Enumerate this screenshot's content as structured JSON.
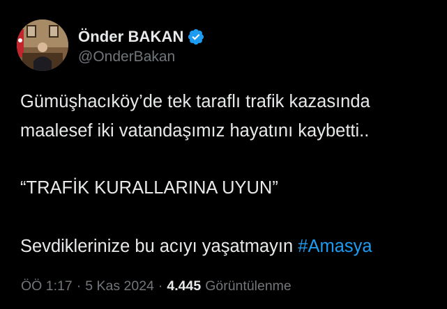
{
  "author": {
    "display_name": "Önder BAKAN",
    "handle": "@OnderBakan",
    "verified_icon": "verified-badge-icon",
    "accent_color": "#1d9bf0"
  },
  "tweet": {
    "line1": "Gümüşhacıköy’de tek taraflı trafik kazasında",
    "line2": "maalesef iki vatandaşımız hayatını kaybetti..",
    "line3": "“TRAFİK KURALLARINA UYUN”",
    "line4_text": "Sevdiklerinize bu acıyı yaşatmayın ",
    "hashtag": "#Amasya"
  },
  "meta": {
    "time": "ÖÖ 1:17",
    "separator": "·",
    "date": "5 Kas 2024",
    "views_count": "4.445",
    "views_label": "Görüntülenme"
  }
}
